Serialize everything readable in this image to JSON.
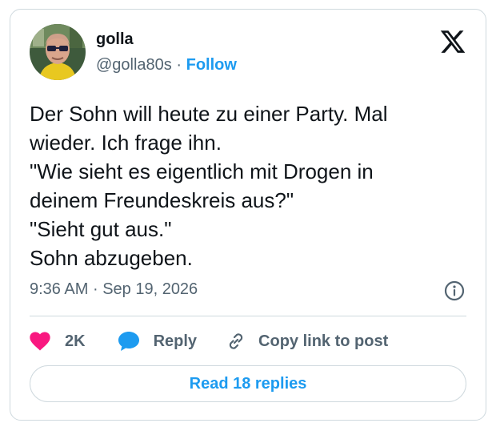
{
  "author": {
    "name": "golla",
    "handle": "@golla80s",
    "separator": "·",
    "follow_label": "Follow"
  },
  "tweet": {
    "lines": [
      "Der Sohn will heute zu einer Party. Mal",
      "wieder. Ich frage ihn.",
      "\"Wie sieht es eigentlich mit Drogen in",
      "deinem Freundeskreis aus?\"",
      "\"Sieht gut aus.\"",
      "Sohn abzugeben."
    ],
    "time": "9:36 AM",
    "separator": "·",
    "date": "Sep 19, 2026"
  },
  "actions": {
    "like_count": "2K",
    "reply_label": "Reply",
    "copy_label": "Copy link to post"
  },
  "read_replies_label": "Read 18 replies",
  "icons": {
    "brand": "x-logo-icon",
    "like": "heart-icon",
    "reply": "speech-bubble-icon",
    "copy": "link-icon",
    "info": "info-icon"
  },
  "colors": {
    "accent": "#1d9bf0",
    "like": "#f91880",
    "text_primary": "#0f1419",
    "text_secondary": "#536471",
    "border": "#cfd9de"
  }
}
